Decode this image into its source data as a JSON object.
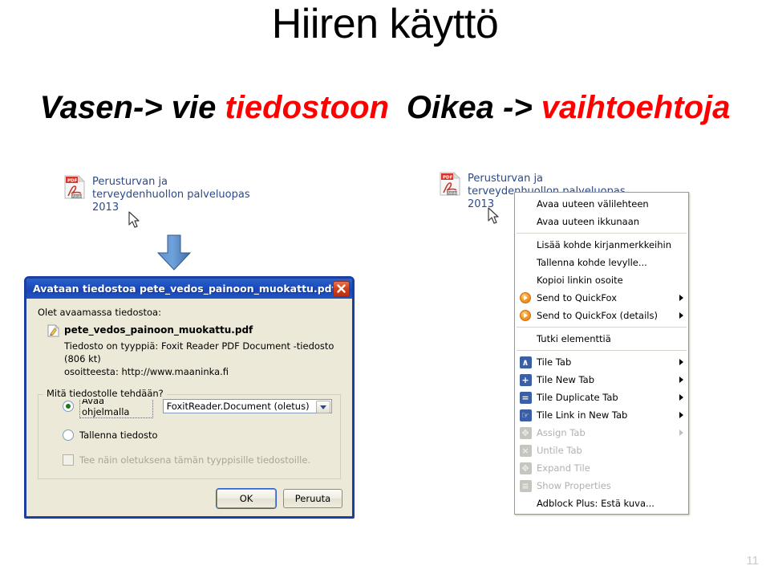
{
  "slide": {
    "title": "Hiiren käyttö",
    "subtitle": {
      "part1": "Vasen-> vie ",
      "part2_red": "tiedostoon",
      "part3": "Oikea -> ",
      "part4_red": "vaihtoehtoja"
    },
    "page_number": "11",
    "colors": {
      "accent_red": "#ff0000",
      "link_blue": "#2a4a8c",
      "dialog_blue": "#1b3fa0",
      "arrow_blue": "#4a86c8"
    }
  },
  "left_example": {
    "pdf_link_text": "Perusturvan ja terveydenhuollon palveluopas 2013",
    "pdf_icon_name": "pdf-file-icon",
    "cursor_icon_name": "mouse-pointer-icon",
    "arrow_icon_name": "download-arrow-icon"
  },
  "right_example": {
    "pdf_link_text": "Perusturvan ja terveydenhuollon palveluopas 2013",
    "pdf_icon_name": "pdf-file-icon",
    "cursor_icon_name": "mouse-pointer-icon"
  },
  "dialog": {
    "title": "Avataan tiedostoa pete_vedos_painoon_muokattu.pdf",
    "close_icon_name": "close-icon",
    "intro": "Olet avaamassa tiedostoa:",
    "file_name": "pete_vedos_painoon_muokattu.pdf",
    "file_icon_name": "document-edit-icon",
    "file_type_line": "Tiedosto on tyyppiä:  Foxit Reader PDF Document -tiedosto (806 kt)",
    "file_source_line": "osoitteesta:  http://www.maaninka.fi",
    "fieldset_legend": "Mitä tiedostolle tehdään?",
    "radio_open_label": "Avaa ohjelmalla",
    "radio_open_accesskey": "A",
    "combo_value": "FoxitReader.Document (oletus)",
    "combo_arrow_icon_name": "chevron-down-icon",
    "radio_save_label": "Tallenna tiedosto",
    "radio_save_accesskey": "T",
    "checkbox_label": "Tee näin oletuksena tämän tyyppisille tiedostoille.",
    "ok_label": "OK",
    "cancel_label": "Peruuta"
  },
  "context_menu": {
    "groups": [
      {
        "items": [
          {
            "label": "Avaa uuteen välilehteen",
            "icon": "",
            "disabled": false,
            "submenu": false
          },
          {
            "label": "Avaa uuteen ikkunaan",
            "icon": "",
            "disabled": false,
            "submenu": false
          }
        ]
      },
      {
        "items": [
          {
            "label": "Lisää kohde kirjanmerkkeihin",
            "icon": "",
            "disabled": false,
            "submenu": false
          },
          {
            "label": "Tallenna kohde levylle...",
            "icon": "",
            "disabled": false,
            "submenu": false
          },
          {
            "label": "Kopioi linkin osoite",
            "icon": "",
            "disabled": false,
            "submenu": false
          },
          {
            "label": "Send to QuickFox",
            "icon": "quickfox-icon",
            "disabled": false,
            "submenu": true
          },
          {
            "label": "Send to QuickFox (details)",
            "icon": "quickfox-icon",
            "disabled": false,
            "submenu": true
          }
        ]
      },
      {
        "items": [
          {
            "label": "Tutki elementtiä",
            "icon": "",
            "disabled": false,
            "submenu": false
          }
        ]
      },
      {
        "items": [
          {
            "label": "Tile Tab",
            "icon": "tile-tab-icon",
            "glyph": "∧",
            "disabled": false,
            "submenu": true
          },
          {
            "label": "Tile New Tab",
            "icon": "tile-new-tab-icon",
            "glyph": "+",
            "disabled": false,
            "submenu": true
          },
          {
            "label": "Tile Duplicate Tab",
            "icon": "tile-duplicate-tab-icon",
            "glyph": "=",
            "disabled": false,
            "submenu": true
          },
          {
            "label": "Tile Link in New Tab",
            "icon": "tile-link-new-tab-icon",
            "glyph": "☞",
            "disabled": false,
            "submenu": true
          },
          {
            "label": "Assign Tab",
            "icon": "assign-tab-icon",
            "glyph": "✥",
            "disabled": true,
            "submenu": true
          },
          {
            "label": "Untile Tab",
            "icon": "untile-tab-icon",
            "glyph": "×",
            "disabled": true,
            "submenu": false
          },
          {
            "label": "Expand Tile",
            "icon": "expand-tile-icon",
            "glyph": "✥",
            "disabled": true,
            "submenu": false
          },
          {
            "label": "Show Properties",
            "icon": "show-properties-icon",
            "glyph": "≡",
            "disabled": true,
            "submenu": false
          },
          {
            "label": "Adblock Plus: Estä kuva...",
            "icon": "",
            "disabled": false,
            "submenu": false
          }
        ]
      }
    ]
  }
}
